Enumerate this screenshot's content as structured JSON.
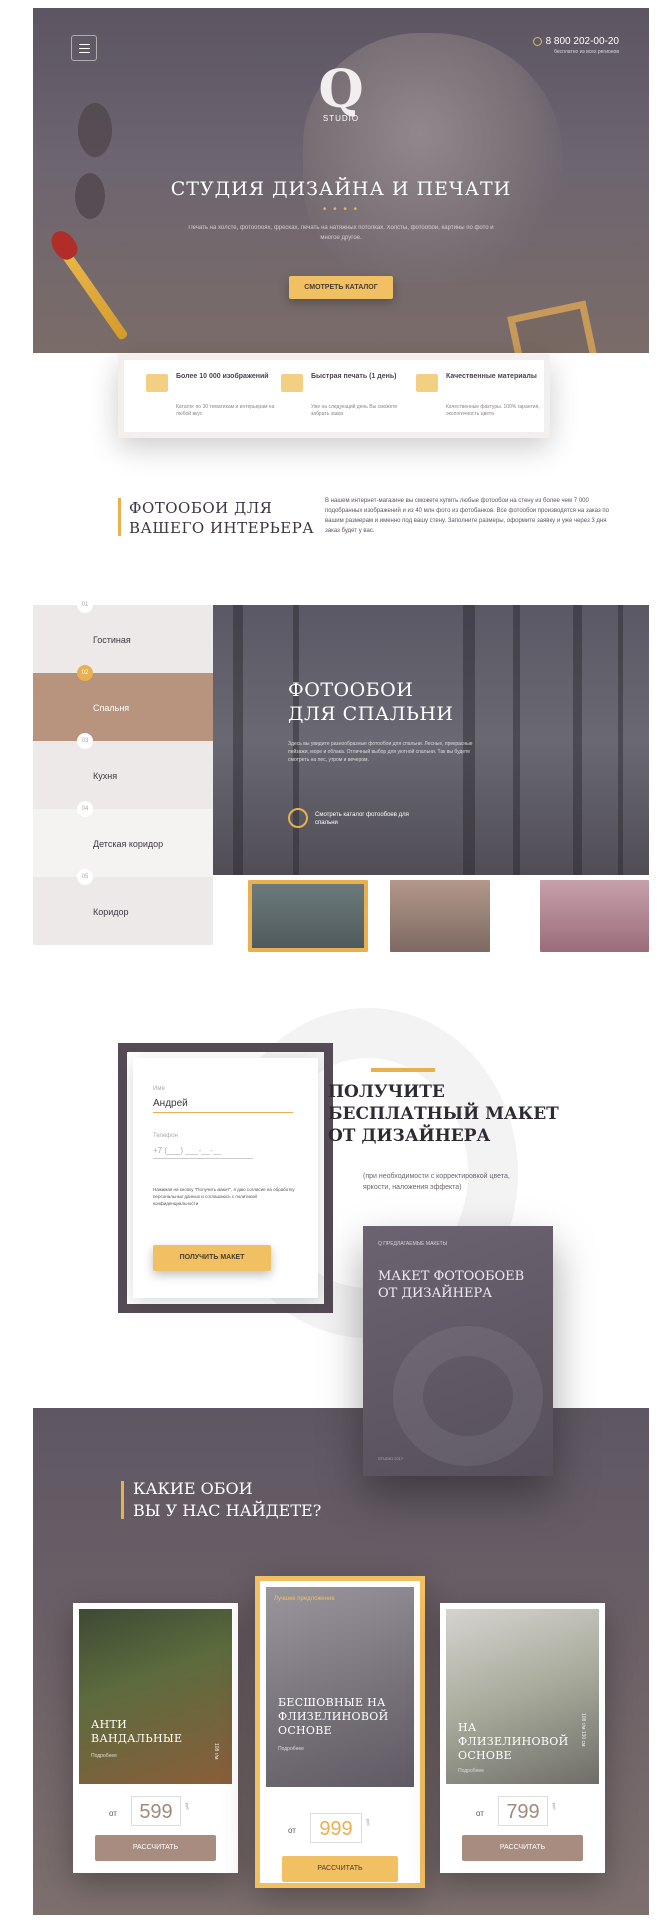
{
  "header": {
    "menu_icon": "hamburger-menu-icon",
    "phone": "8 800 202-00-20",
    "phone_sub": "бесплатно из всех регионов",
    "logo_letter": "Q",
    "logo_text": "STUDIO"
  },
  "hero": {
    "title": "СТУДИЯ ДИЗАЙНА И ПЕЧАТИ",
    "dots": "• • • •",
    "subtitle": "Печать на холсте, фотообоях, фресках, печать на натяжных потолках. Холсты, фотообои, картины по фото и многое другое.",
    "button": "СМОТРЕТЬ КАТАЛОГ"
  },
  "features": [
    {
      "title": "Более 10 000 изображений",
      "text": "Каталог по 30 тематикам и интерьерам на любой вкус"
    },
    {
      "title": "Быстрая печать (1 день)",
      "text": "Уже на следующий день Вы сможете забрать заказ"
    },
    {
      "title": "Качественные материалы",
      "text": "Качественные фактуры. 100% гарантия, экологичность цвета"
    }
  ],
  "about": {
    "title_line1": "ФОТООБОИ ДЛЯ",
    "title_line2": "ВАШЕГО ИНТЕРЬЕРА",
    "text": "В нашем интернет-магазине вы сможете купить любые фотообои на стену из более чем 7 000 подобранных изображений и из 40 млн фото из фотобанков. Все фотообои производятся на заказ по вашим размерам и именно под вашу стену. Заполните размеры, оформите заявку и уже через 3 дня заказ будет у вас."
  },
  "rooms": {
    "items": [
      {
        "num": "01",
        "label": "Гостиная"
      },
      {
        "num": "02",
        "label": "Спальня"
      },
      {
        "num": "03",
        "label": "Кухня"
      },
      {
        "num": "04",
        "label": "Детская коридор"
      },
      {
        "num": "05",
        "label": "Коридор"
      }
    ],
    "active_title_line1": "ФОТООБОИ",
    "active_title_line2": "ДЛЯ СПАЛЬНИ",
    "active_text": "Здесь вы увидите разнообразные фотообои для спальни. Лесные, прекрасные пейзажи, море и облака. Отличный выбор для уютной спальни. Так вы будете смотреть на лес, утром и вечером.",
    "link": "Смотреть каталог фотообоев для спальни"
  },
  "form": {
    "name_label": "Имя",
    "name_value": "Андрей",
    "phone_label": "Телефон",
    "phone_placeholder": "+7 (___) ___-__-__",
    "note": "Нажимая на кнопку \"Получить макет\", я даю согласие на обработку персональных данных и соглашаюсь с политикой конфиденциальности",
    "button": "ПОЛУЧИТЬ МАКЕТ",
    "heading_line1": "ПОЛУЧИТЕ",
    "heading_line2": "БЕСПЛАТНЫЙ МАКЕТ",
    "heading_line3": "ОТ ДИЗАЙНЕРА",
    "sub": "(при необходимости с корректировкой цвета, яркости, наложения эффекта)"
  },
  "book": {
    "top": "Q ПРЕДЛАГАЕМЫЕ МАКЕТЫ",
    "title": "МАКЕТ ФОТООБОЕВ ОТ ДИЗАЙНЕРА",
    "footer": "STUDIO 2017"
  },
  "types": {
    "title_line1": "КАКИЕ ОБОИ",
    "title_line2": "ВЫ У НАС НАЙДЕТЕ?",
    "cards": [
      {
        "title": "АНТИ ВАНДАЛЬНЫЕ",
        "sub": "Подробнее",
        "price_from": "от",
        "price": "599",
        "unit": "руб",
        "size": "108 г/м",
        "button": "РАССЧИТАТЬ"
      },
      {
        "title": "БЕСШОВНЫЕ НА ФЛИЗЕЛИНОВОЙ ОСНОВЕ",
        "sub": "Подробнее",
        "price_from": "от",
        "price": "999",
        "unit": "руб",
        "size": "",
        "badge": "Лучшее предложение",
        "button": "РАССЧИТАТЬ"
      },
      {
        "title": "НА ФЛИЗЕЛИНОВОЙ ОСНОВЕ",
        "sub": "Подробнее",
        "price_from": "от",
        "price": "799",
        "unit": "руб",
        "size": "108 г/м 130 см",
        "button": "РАССЧИТАТЬ"
      }
    ]
  },
  "colors": {
    "accent": "#e8b04f",
    "button_gold": "#f1c063",
    "dark": "#554c55",
    "room_active": "#b8937e"
  }
}
